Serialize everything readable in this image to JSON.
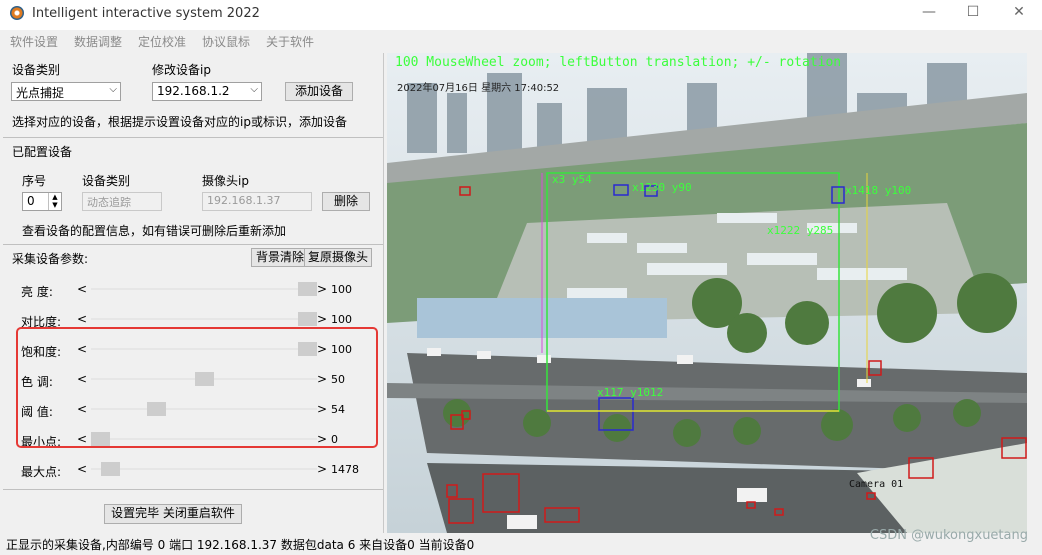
{
  "window": {
    "title": "Intelligent interactive system 2022",
    "minimize": "—",
    "maximize": "☐",
    "close": "✕"
  },
  "menu": [
    "软件设置",
    "数据调整",
    "定位校准",
    "协议鼠标",
    "关于软件"
  ],
  "device": {
    "type_label": "设备类别",
    "type_value": "光点捕捉",
    "ip_label": "修改设备ip",
    "ip_value": "192.168.1.2",
    "add_button": "添加设备",
    "hint": "选择对应的设备，根据提示设置设备对应的ip或标识，添加设备"
  },
  "configured": {
    "section": "已配置设备",
    "col_index": "序号",
    "col_type": "设备类别",
    "col_ip": "摄像头ip",
    "index_value": "0",
    "type_value": "动态追踪",
    "ip_value": "192.168.1.37",
    "delete_button": "删除",
    "hint": "查看设备的配置信息，如有错误可删除后重新添加"
  },
  "params": {
    "section": "采集设备参数:",
    "bg_clear_button": "背景清除",
    "restore_camera_button": "复原摄像头",
    "left_arrow": "<",
    "right_arrow": ">",
    "sliders": [
      {
        "name": "亮  度:",
        "value": "100",
        "level": 1.0
      },
      {
        "name": "对比度:",
        "value": "100",
        "level": 1.0
      },
      {
        "name": "饱和度:",
        "value": "100",
        "level": 1.0
      },
      {
        "name": "色  调:",
        "value": "50",
        "level": 0.5
      },
      {
        "name": "阈  值:",
        "value": "54",
        "level": 0.27
      },
      {
        "name": "最小点:",
        "value": "0",
        "level": 0.0
      },
      {
        "name": "最大点:",
        "value": "1478",
        "level": 0.05
      }
    ],
    "finish_button": "设置完毕 关闭重启软件"
  },
  "video": {
    "overlay_text": "100 MouseWheel zoom; leftButton translation; +/- rotation",
    "timestamp": "2022年07月16日 星期六 17:40:52",
    "camera_label": "Camera 01",
    "labels": [
      "x3 y54",
      "x1230 y90",
      "x1418 y100",
      "x1222 y285",
      "x117 y1012"
    ]
  },
  "status": "正显示的采集设备,内部编号 0 端口 192.168.1.37 数据包data 6 来自设备0 当前设备0",
  "watermark": "CSDN @wukongxuetang",
  "colors": {
    "accent_red": "#e53935",
    "overlay_green": "#3cff3c"
  }
}
